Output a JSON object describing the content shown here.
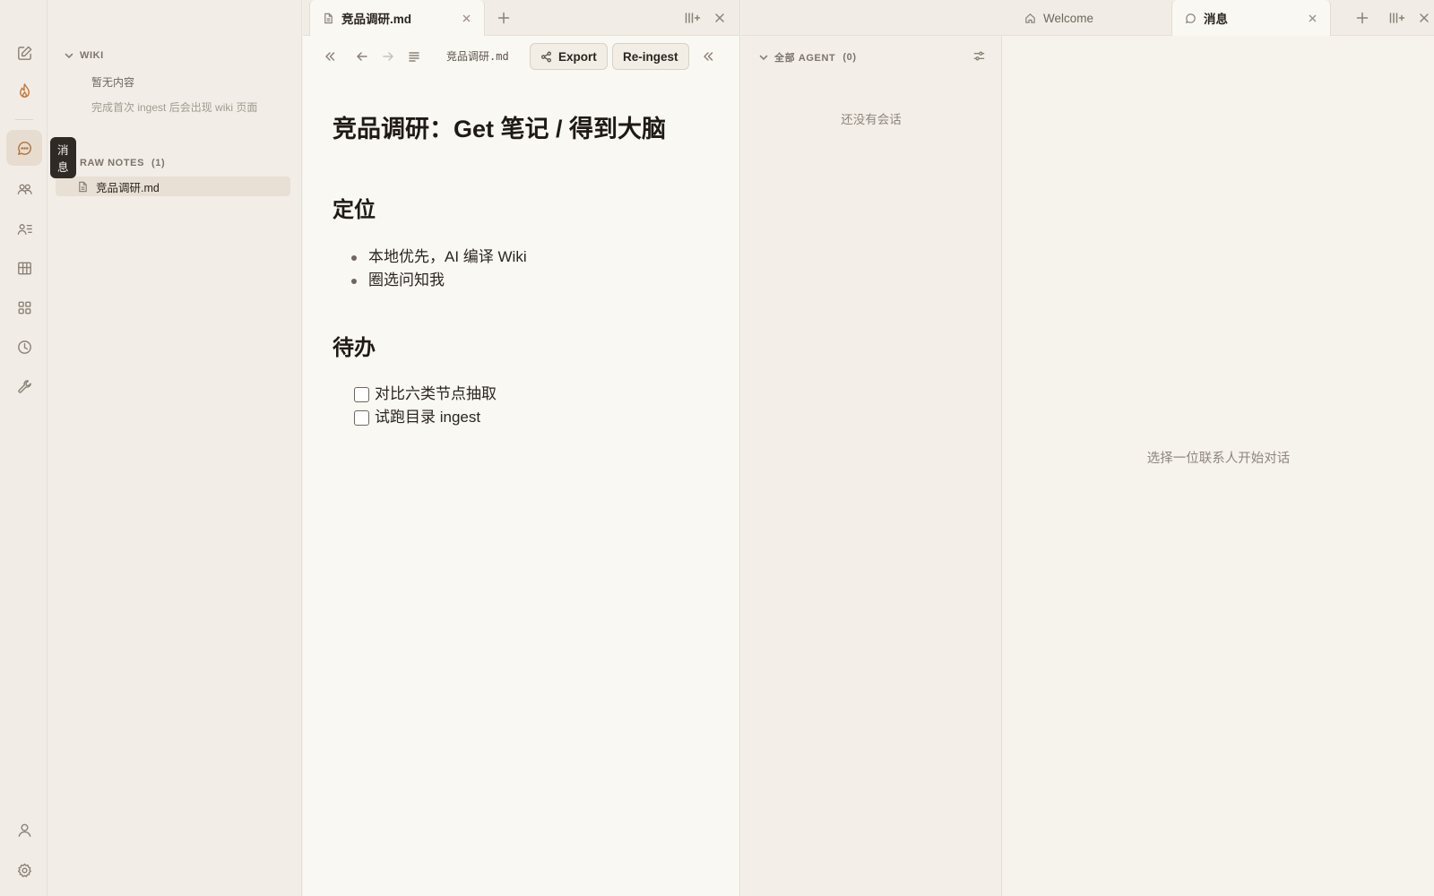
{
  "activity_bar": {
    "tooltip": "消息",
    "items": [
      {
        "name": "edit-icon"
      },
      {
        "name": "flame-icon"
      },
      {
        "name": "chat-icon"
      },
      {
        "name": "people-icon"
      },
      {
        "name": "contacts-icon"
      },
      {
        "name": "board-icon"
      },
      {
        "name": "apps-icon"
      },
      {
        "name": "clock-icon"
      },
      {
        "name": "wrench-icon"
      },
      {
        "name": "user-icon"
      },
      {
        "name": "settings-icon"
      }
    ],
    "active": "chat-icon"
  },
  "sidebar": {
    "wiki": {
      "title": "WIKI",
      "empty": "暂无内容",
      "hint": "完成首次 ingest 后会出现 wiki 页面"
    },
    "raw_notes": {
      "title": "RAW NOTES",
      "count": "(1)",
      "files": [
        "竞品调研.md"
      ]
    }
  },
  "editor": {
    "tab_title": "竞品调研.md",
    "breadcrumb": "竞品调研.md",
    "export_label": "Export",
    "reingest_label": "Re-ingest",
    "doc": {
      "title": "竞品调研：Get 笔记 / 得到大脑",
      "section1": "定位",
      "bullets": [
        "本地优先，AI 编译 Wiki",
        "圈选问知我"
      ],
      "section2": "待办",
      "todos": [
        "对比六类节点抽取",
        "试跑目录 ingest"
      ]
    }
  },
  "right_panel": {
    "tabs": [
      "Welcome",
      "消息"
    ],
    "active_tab": "消息",
    "agent_header": "全部 AGENT",
    "agent_count": "(0)",
    "no_conversations": "还没有会话",
    "chat_placeholder": "选择一位联系人开始对话"
  },
  "colors": {
    "accent": "#b0733c",
    "background": "#f5f1ea",
    "editor_bg": "#faf8f3"
  }
}
